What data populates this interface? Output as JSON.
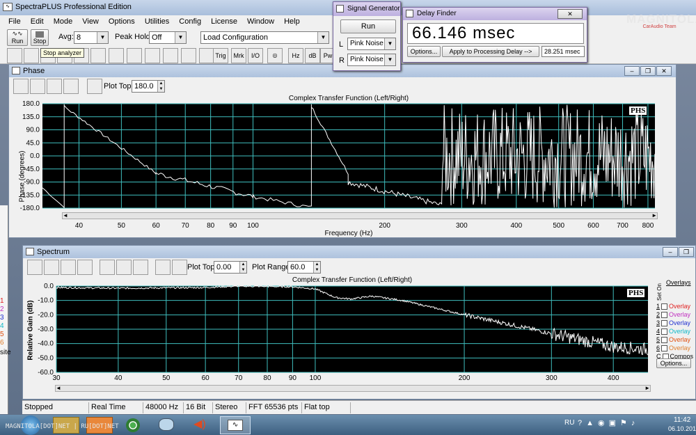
{
  "main": {
    "title": "SpectraPLUS Professional Edition",
    "menu": [
      "File",
      "Edit",
      "Mode",
      "View",
      "Options",
      "Utilities",
      "Config",
      "License",
      "Window",
      "Help"
    ],
    "run_label": "Run",
    "stop_label": "Stop",
    "avg_label": "Avg:",
    "avg_value": "8",
    "peak_label": "Peak Hold:",
    "peak_value": "Off",
    "load_config": "Load Configuration",
    "tooltip": "Stop analyzer",
    "toolbar_text_buttons": [
      "Trig",
      "Mrk",
      "I/O",
      "Hz",
      "dB",
      "Pw"
    ]
  },
  "siggen": {
    "title": "Signal Generator",
    "run_label": "Run",
    "l_label": "L",
    "r_label": "R",
    "l_value": "Pink Noise",
    "r_value": "Pink Noise"
  },
  "delay": {
    "title": "Delay Finder",
    "value": "66.146 msec",
    "options_label": "Options...",
    "apply_label": "Apply to Processing Delay -->",
    "field_value": "28.251 msec"
  },
  "phase": {
    "title": "Phase",
    "plot_top_label": "Plot Top:",
    "plot_top_value": "180.0",
    "chart_title": "Complex Transfer Function (Left/Right)",
    "y_label": "Phase (degrees)",
    "x_label": "Frequency (Hz)",
    "phs": "PHS",
    "y_ticks": [
      "180.0",
      "135.0",
      "90.0",
      "45.0",
      "0.0",
      "-45.0",
      "-90.0",
      "-135.0",
      "-180.0"
    ],
    "x_ticks": [
      "40",
      "50",
      "60",
      "70",
      "80",
      "90",
      "100",
      "200",
      "300",
      "400",
      "500",
      "600",
      "700",
      "800"
    ]
  },
  "spectrum": {
    "title": "Spectrum",
    "plot_top_label": "Plot Top:",
    "plot_top_value": "0.00",
    "plot_range_label": "Plot Range:",
    "plot_range_value": "60.0",
    "chart_title": "Complex Transfer Function (Left/Right)",
    "y_label": "Relative Gain (dB)",
    "phs": "PHS",
    "y_ticks": [
      "0.0",
      "-10.0",
      "-20.0",
      "-30.0",
      "-40.0",
      "-50.0",
      "-60.0"
    ],
    "x_ticks": [
      "30",
      "40",
      "50",
      "60",
      "70",
      "80",
      "90",
      "100",
      "200",
      "300",
      "400"
    ],
    "overlays_header": "Overlays",
    "set_on": "Set On",
    "overlays": [
      {
        "num": "1",
        "label": "Overlay",
        "color": "#e02020"
      },
      {
        "num": "2",
        "label": "Overlay",
        "color": "#c030c0"
      },
      {
        "num": "3",
        "label": "Overlay",
        "color": "#2030d0"
      },
      {
        "num": "4",
        "label": "Overlay",
        "color": "#10b8c8"
      },
      {
        "num": "5",
        "label": "Overlay",
        "color": "#e05010"
      },
      {
        "num": "6",
        "label": "Overlay",
        "color": "#e08030"
      }
    ],
    "composite": {
      "num": "C",
      "label": "Compos"
    },
    "options_label": "Options..."
  },
  "status": [
    "Stopped",
    "Real Time",
    "48000 Hz",
    "16 Bit",
    "Stereo",
    "FFT 65536 pts",
    "Flat top"
  ],
  "left_numbers": [
    "1",
    "2",
    "3",
    "4",
    "5",
    "6"
  ],
  "left_fragment": "site",
  "taskbar": {
    "watermark": "MAGNITOLA[DOT]NET | RU[DOT]NET",
    "lang": "RU",
    "time": "11:42",
    "date": "06.10.201"
  },
  "logo": {
    "text": "MAGNITOLA",
    "sub": "CarAudio Team"
  },
  "colors": {
    "grid": "#3fbfbf",
    "trace": "#ffffff",
    "plot_bg": "#000000",
    "panel": "#f0f0f0"
  }
}
